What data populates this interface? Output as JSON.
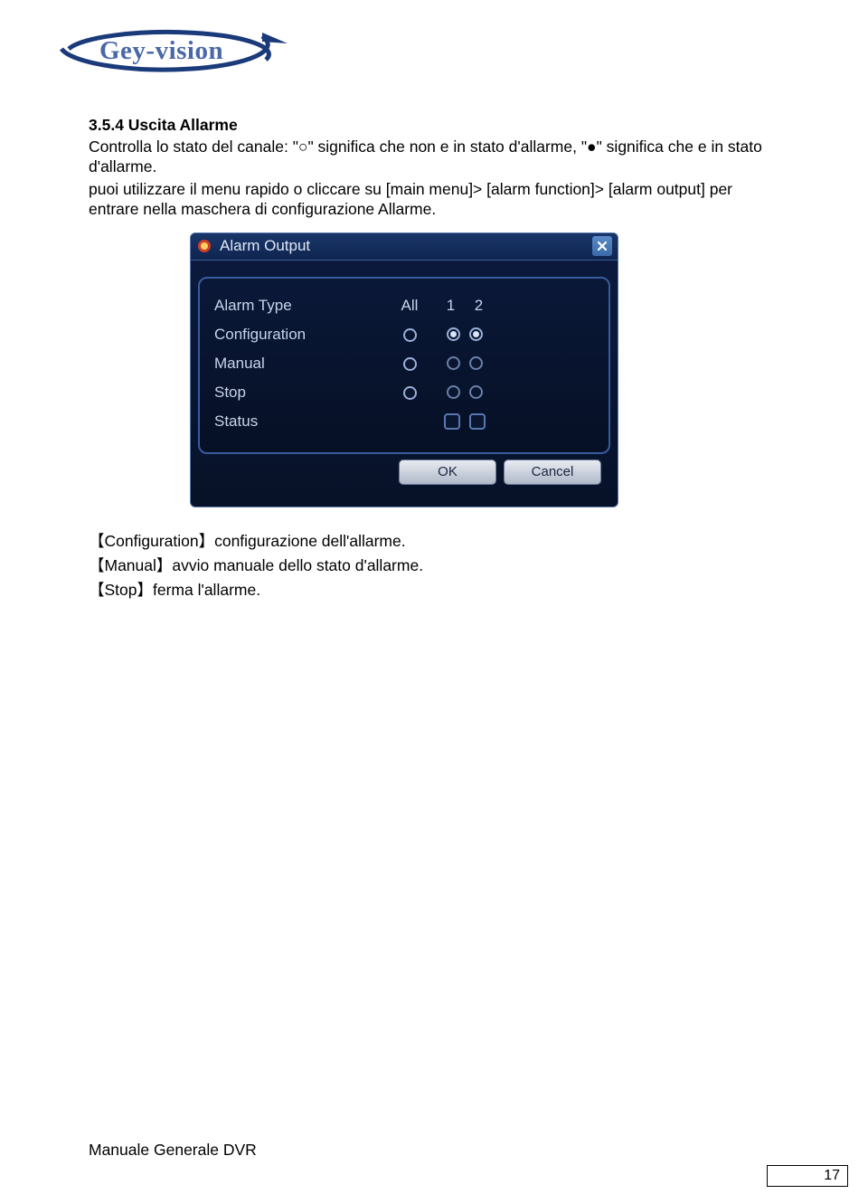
{
  "logo": {
    "text": "Gey-vision"
  },
  "section": {
    "heading": "3.5.4 Uscita Allarme",
    "p1": "Controlla lo stato del canale: \"○\" significa che non e in stato d'allarme, \"●\" significa che e in stato d'allarme.",
    "p2": "puoi utilizzare il menu rapido o cliccare su [main menu]> [alarm function]> [alarm output] per entrare nella maschera di configurazione Allarme."
  },
  "dialog": {
    "title": "Alarm Output",
    "columns": {
      "all": "All",
      "c1": "1",
      "c2": "2"
    },
    "rows": {
      "type": "Alarm Type",
      "config": "Configuration",
      "manual": "Manual",
      "stop": "Stop",
      "status": "Status"
    },
    "radios": {
      "config": {
        "all": "empty",
        "c1": "filled",
        "c2": "filled"
      },
      "manual": {
        "all": "empty",
        "c1": "empty",
        "c2": "empty"
      },
      "stop": {
        "all": "empty",
        "c1": "empty",
        "c2": "empty"
      }
    },
    "buttons": {
      "ok": "OK",
      "cancel": "Cancel"
    }
  },
  "defs": {
    "d1": "【Configuration】configurazione dell'allarme.",
    "d2": "【Manual】avvio manuale dello stato d'allarme.",
    "d3": "【Stop】ferma l'allarme."
  },
  "footer": {
    "label": "Manuale Generale DVR"
  },
  "page": "17"
}
